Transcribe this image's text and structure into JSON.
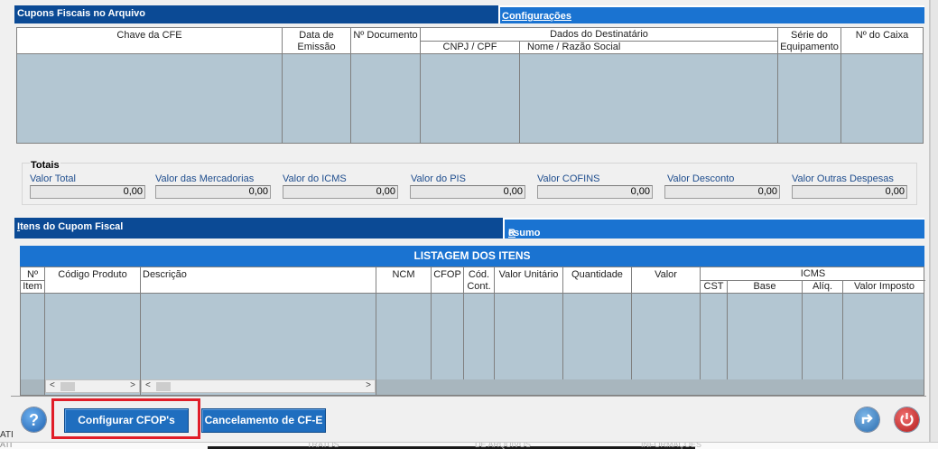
{
  "cupons_panel": {
    "title": "Cupons Fiscais no Arquivo",
    "config_tab": "Configurações",
    "columns": {
      "chave": "Chave da CFE",
      "data_l1": "Data de",
      "data_l2": "Emissão",
      "documento": "Nº Documento",
      "destinatario": "Dados do Destinatário",
      "cnpj": "CNPJ / CPF",
      "nome": "Nome / Razão Social",
      "serie_l1": "Série do",
      "serie_l2": "Equipamento",
      "caixa": "Nº do Caixa"
    }
  },
  "totais": {
    "title": "Totais",
    "fields": [
      {
        "label": "Valor Total",
        "value": "0,00"
      },
      {
        "label": "Valor das Mercadorias",
        "value": "0,00"
      },
      {
        "label": "Valor do ICMS",
        "value": "0,00"
      },
      {
        "label": "Valor do PIS",
        "value": "0,00"
      },
      {
        "label": "Valor COFINS",
        "value": "0,00"
      },
      {
        "label": "Valor Desconto",
        "value": "0,00"
      },
      {
        "label": "Valor Outras Despesas",
        "value": "0,00"
      }
    ]
  },
  "itens_panel": {
    "title_prefix": "I",
    "title_rest": "tens do Cupom Fiscal",
    "resumo_tab_prefix": "R",
    "resumo_tab_rest": "esumo",
    "listagem_title": "LISTAGEM DOS ITENS",
    "columns": {
      "num_l1": "Nº",
      "num_l2": "Item",
      "codigo": "Código Produto",
      "descricao": "Descrição",
      "ncm": "NCM",
      "cfop": "CFOP",
      "cod_l1": "Cód.",
      "cod_l2": "Cont.",
      "valor_unitario": "Valor Unitário",
      "quantidade": "Quantidade",
      "valor": "Valor",
      "icms": "ICMS",
      "cst": "CST",
      "base": "Base",
      "aliq": "Alíq.",
      "valor_imposto": "Valor Imposto"
    }
  },
  "footer": {
    "configurar_cfops": "Configurar CFOP's",
    "cancelamento": "Cancelamento de CF-E",
    "left_edge_text": "ATI"
  },
  "bottom_strip": [
    "ATI",
    "TRATOS",
    "DE ARQUIVOS",
    "INFORMAÇÕES"
  ],
  "colors": {
    "panel_title_bg": "#0b4a95",
    "tab_bg": "#1a73d1",
    "grid_bg": "#b3c6d2",
    "highlight": "#e01d28",
    "button_bg": "#1f6ebf"
  }
}
